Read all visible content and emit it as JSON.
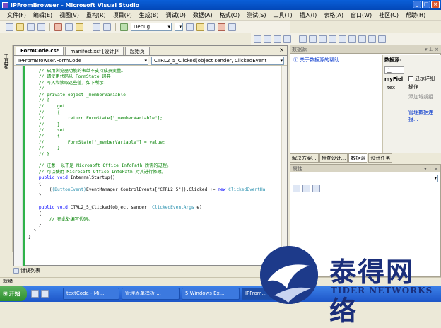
{
  "window": {
    "title": "IPFromBrowser - Microsoft Visual Studio"
  },
  "menu": [
    "文件(F)",
    "编辑(E)",
    "视图(V)",
    "重构(R)",
    "项目(P)",
    "生成(B)",
    "调试(D)",
    "数据(A)",
    "格式(O)",
    "测试(S)",
    "工具(T)",
    "插入(I)",
    "表格(A)",
    "窗口(W)",
    "社区(C)",
    "帮助(H)"
  ],
  "toolbar": {
    "config": "Debug"
  },
  "left_toolbox": {
    "label": "工具箱"
  },
  "editor": {
    "tabs": [
      "FormCode.cs*",
      "manifest.xsf [设计]*",
      "起始页"
    ],
    "nav_left": "IPFromBrowser.FormCode",
    "nav_right": "CTRL2_5_Clicked(object sender, ClickedEvent"
  },
  "code_lines": [
    {
      "cls": "c",
      "text": "    // 启用浏览器功能的表单不支持成员变量。"
    },
    {
      "cls": "c",
      "text": "    // 请使用代码从 FormState 词典"
    },
    {
      "cls": "c",
      "text": "    // 写入和读取这些值，如下所示:"
    },
    {
      "cls": "c",
      "text": "    //"
    },
    {
      "cls": "c",
      "text": "    // private object _memberVariable"
    },
    {
      "cls": "c",
      "text": "    // {"
    },
    {
      "cls": "c",
      "text": "    //     get"
    },
    {
      "cls": "c",
      "text": "    //     {"
    },
    {
      "cls": "c",
      "text": "    //         return FormState[\"_memberVariable\"];"
    },
    {
      "cls": "c",
      "text": "    //     }"
    },
    {
      "cls": "c",
      "text": "    //     set"
    },
    {
      "cls": "c",
      "text": "    //     {"
    },
    {
      "cls": "c",
      "text": "    //         FormState[\"_memberVariable\"] = value;"
    },
    {
      "cls": "c",
      "text": "    //     }"
    },
    {
      "cls": "c",
      "text": "    // }"
    },
    {
      "cls": "n",
      "text": ""
    },
    {
      "cls": "c",
      "text": "    // 注意: 以下是 Microsoft Office InfoPath 所需的过程。"
    },
    {
      "cls": "c",
      "text": "    // 可以使用 Microsoft Office InfoPath 对其进行修改。"
    },
    {
      "cls": "mix1",
      "text": ""
    },
    {
      "cls": "n",
      "text": "    {"
    },
    {
      "cls": "mix2",
      "text": ""
    },
    {
      "cls": "n",
      "text": "    }"
    },
    {
      "cls": "n",
      "text": ""
    },
    {
      "cls": "mix3",
      "text": ""
    },
    {
      "cls": "n",
      "text": "    {"
    },
    {
      "cls": "c",
      "text": "        // 在此处编写代码。"
    },
    {
      "cls": "n",
      "text": "    }"
    },
    {
      "cls": "n",
      "text": "  }"
    },
    {
      "cls": "n",
      "text": "}"
    }
  ],
  "code_special": {
    "l1_kw": "public void ",
    "l1_rest": "InternalStartup()",
    "l2_cast": "(ButtonEvent)",
    "l2_mid": "EventManager.ControlEvents[\"CTRL2_5\"]).Clicked += ",
    "l2_new": "new ",
    "l2_type": "ClickedEventHa",
    "l3_kw": "public void ",
    "l3_name": "CTRL2_5_Clicked(object sender, ",
    "l3_type": "ClickedEventArgs",
    "l3_end": " e)"
  },
  "bottom": {
    "error_list": "错误列表",
    "status": "就绪"
  },
  "datasource_panel": {
    "title": "数据源",
    "help_link": "关于数据源的帮助",
    "source_label": "数据源:",
    "root": "主",
    "item1": "myFiel",
    "item2": "tex",
    "show_details": "显示详细",
    "actions": "操作",
    "add_node": "添加域或组",
    "manage": "管理数据连接..."
  },
  "panel_tabs": [
    "解决方案...",
    "检查设计...",
    "数据源",
    "设计任务"
  ],
  "properties": {
    "title": "属性"
  },
  "taskbar": {
    "start": "开始",
    "items": [
      "textCode - Mi...",
      "管理表单模板 ...",
      "5 Windows Ex...",
      "IPFrom..."
    ]
  },
  "watermark": {
    "cn": "泰得网络",
    "en": "TIDER NETWORKS"
  }
}
